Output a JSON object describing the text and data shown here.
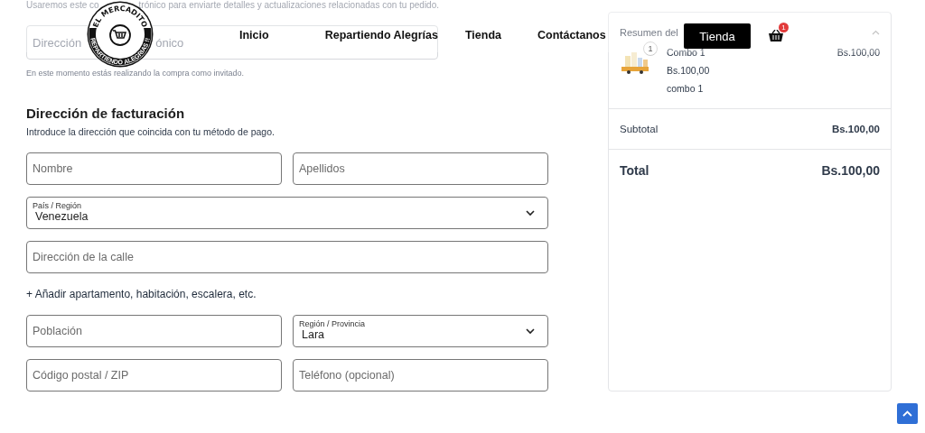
{
  "header": {
    "logo": {
      "top_text": "EL MERCADITO",
      "bottom_text": "REPARTIENDO ALEGRIAS !!"
    },
    "nav": [
      {
        "label": "Inicio"
      },
      {
        "label": "Repartiendo Alegrías"
      },
      {
        "label": "Tienda"
      },
      {
        "label": "Contáctanos"
      }
    ],
    "shop_button": "Tienda",
    "cart_count": "1"
  },
  "contact": {
    "intro_before": "Usaremos este co",
    "intro_after": "trónico para enviarte detalles y actualizaciones relacionadas con tu pedido.",
    "email_placeholder_before": "Dirección",
    "email_placeholder_after": "ónico",
    "note": "En este momento estás realizando la compra como invitado."
  },
  "billing": {
    "title": "Dirección de facturación",
    "subtitle": "Introduce la dirección que coincida con tu método de pago.",
    "rows": [
      [
        {
          "kind": "input",
          "placeholder": "Nombre"
        },
        {
          "kind": "input",
          "placeholder": "Apellidos"
        }
      ],
      [
        {
          "kind": "select",
          "label": "País / Región",
          "value": "Venezuela"
        }
      ],
      [
        {
          "kind": "input",
          "placeholder": "Dirección de la calle"
        }
      ],
      [
        {
          "kind": "link",
          "label": "+ Añadir apartamento, habitación, escalera, etc."
        }
      ],
      [
        {
          "kind": "input",
          "placeholder": "Población"
        },
        {
          "kind": "select",
          "label": "Región / Provincia",
          "value": "Lara"
        }
      ],
      [
        {
          "kind": "input",
          "placeholder": "Código postal / ZIP"
        },
        {
          "kind": "input",
          "placeholder": "Teléfono (opcional)"
        }
      ]
    ]
  },
  "summary": {
    "title": "Resumen del",
    "expanded": true,
    "items": [
      {
        "quantity": "1",
        "name": "Combo 1",
        "price": "Bs.100,00",
        "unit_price": "Bs.100,00",
        "description": "combo 1"
      }
    ],
    "subtotal_label": "Subtotal",
    "subtotal": "Bs.100,00",
    "total_label": "Total",
    "total": "Bs.100,00"
  }
}
